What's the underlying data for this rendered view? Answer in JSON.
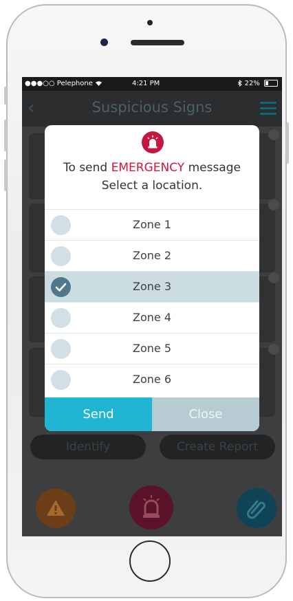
{
  "status_bar": {
    "carrier": "●●●○○ Pelephone",
    "time": "4:21 PM",
    "battery": "22%",
    "icons": [
      "wifi-icon",
      "bluetooth-icon",
      "battery-icon"
    ]
  },
  "app_bar": {
    "title": "Suspicious Signs",
    "back_icon": "chevron-left-icon",
    "menu_icon": "hamburger-menu-icon"
  },
  "modal": {
    "icon": "alarm-siren-icon",
    "line1_prefix": "To send ",
    "line1_highlight": "EMERGENCY",
    "line1_suffix": " message",
    "line2": "Select a location.",
    "zones": [
      {
        "label": "Zone 1",
        "selected": false
      },
      {
        "label": "Zone 2",
        "selected": false
      },
      {
        "label": "Zone 3",
        "selected": true
      },
      {
        "label": "Zone 4",
        "selected": false
      },
      {
        "label": "Zone 5",
        "selected": false
      },
      {
        "label": "Zone 6",
        "selected": false
      }
    ],
    "send_label": "Send",
    "close_label": "Close"
  },
  "background_actions": {
    "identify_label": "Identify",
    "create_report_label": "Create Report",
    "fab_icons": [
      "warning-icon",
      "alarm-siren-icon",
      "paperclip-icon"
    ]
  },
  "colors": {
    "emergency": "#d4163d",
    "send_button": "#20b5d2",
    "close_button": "#b7ccd2",
    "selected_row": "#ccdde2",
    "alarm_icon_bg": "#c4163f"
  }
}
